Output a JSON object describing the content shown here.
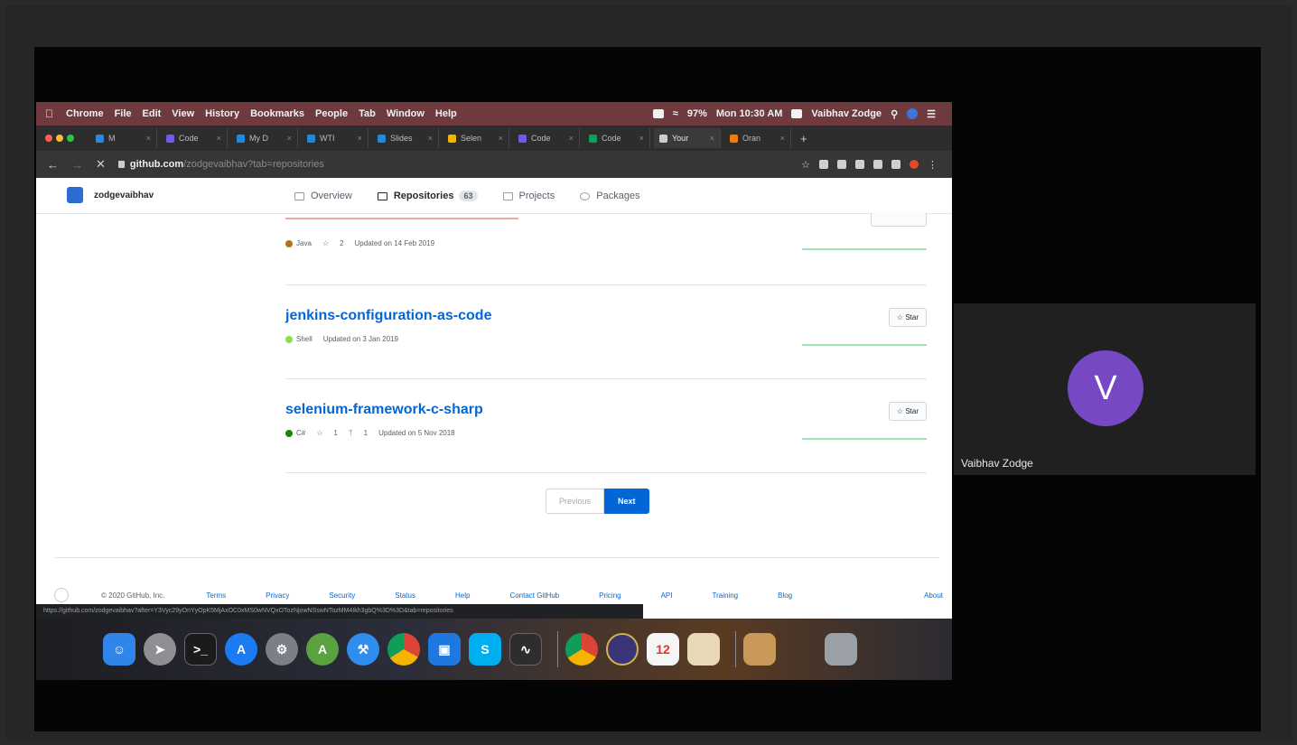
{
  "menubar": {
    "items": [
      "Chrome",
      "File",
      "Edit",
      "View",
      "History",
      "Bookmarks",
      "People",
      "Tab",
      "Window",
      "Help"
    ],
    "battery": "97%",
    "clock": "Mon 10:30 AM",
    "user": "Vaibhav Zodge"
  },
  "tabs": [
    {
      "label": "M",
      "color": "#2e86de"
    },
    {
      "label": "Code",
      "color": "#6c5ce7"
    },
    {
      "label": "My D",
      "color": "#1e88e5"
    },
    {
      "label": "WTI",
      "color": "#1e88e5"
    },
    {
      "label": "Slides",
      "color": "#1e88e5"
    },
    {
      "label": "Selen",
      "color": "#f4b400"
    },
    {
      "label": "Code",
      "color": "#6c5ce7"
    },
    {
      "label": "Code",
      "color": "#0f9d58"
    },
    {
      "label": "Your",
      "color": "#cccccc"
    },
    {
      "label": "Oran",
      "color": "#f57c00"
    }
  ],
  "address": {
    "host": "github.com",
    "path": "/zodgevaibhav?tab=repositories"
  },
  "github": {
    "username": "zodgevaibhav",
    "tabs": {
      "overview": "Overview",
      "repositories": "Repositories",
      "repo_count": "63",
      "projects": "Projects",
      "packages": "Packages"
    },
    "repos": [
      {
        "name": "",
        "lang": "Java",
        "lang_color": "#b07219",
        "stars": "2",
        "forks": "",
        "updated": "Updated on 14 Feb 2019"
      },
      {
        "name": "jenkins-configuration-as-code",
        "lang": "Shell",
        "lang_color": "#89e051",
        "stars": "",
        "forks": "",
        "updated": "Updated on 3 Jan 2019",
        "star_label": "Star"
      },
      {
        "name": "selenium-framework-c-sharp",
        "lang": "C#",
        "lang_color": "#178600",
        "stars": "1",
        "forks": "1",
        "updated": "Updated on 5 Nov 2018",
        "star_label": "Star"
      }
    ],
    "pagination": {
      "previous": "Previous",
      "next": "Next"
    },
    "footer": {
      "copyright": "© 2020 GitHub, Inc.",
      "links": [
        "Terms",
        "Privacy",
        "Security",
        "Status",
        "Help",
        "Contact GitHub",
        "Pricing",
        "API",
        "Training",
        "Blog",
        "About"
      ]
    }
  },
  "status_url": "https://github.com/zodgevaibhav?after=Y3Vyc29yOnYyOpK5MjAxOC0xMS0wNVQxOTozNjowNSswNTozMM4Ikh3gbQ%3D%3D&tab=repositories",
  "participant": {
    "initial": "V",
    "name": "Vaibhav Zodge",
    "avatar_color": "#7748c4"
  }
}
